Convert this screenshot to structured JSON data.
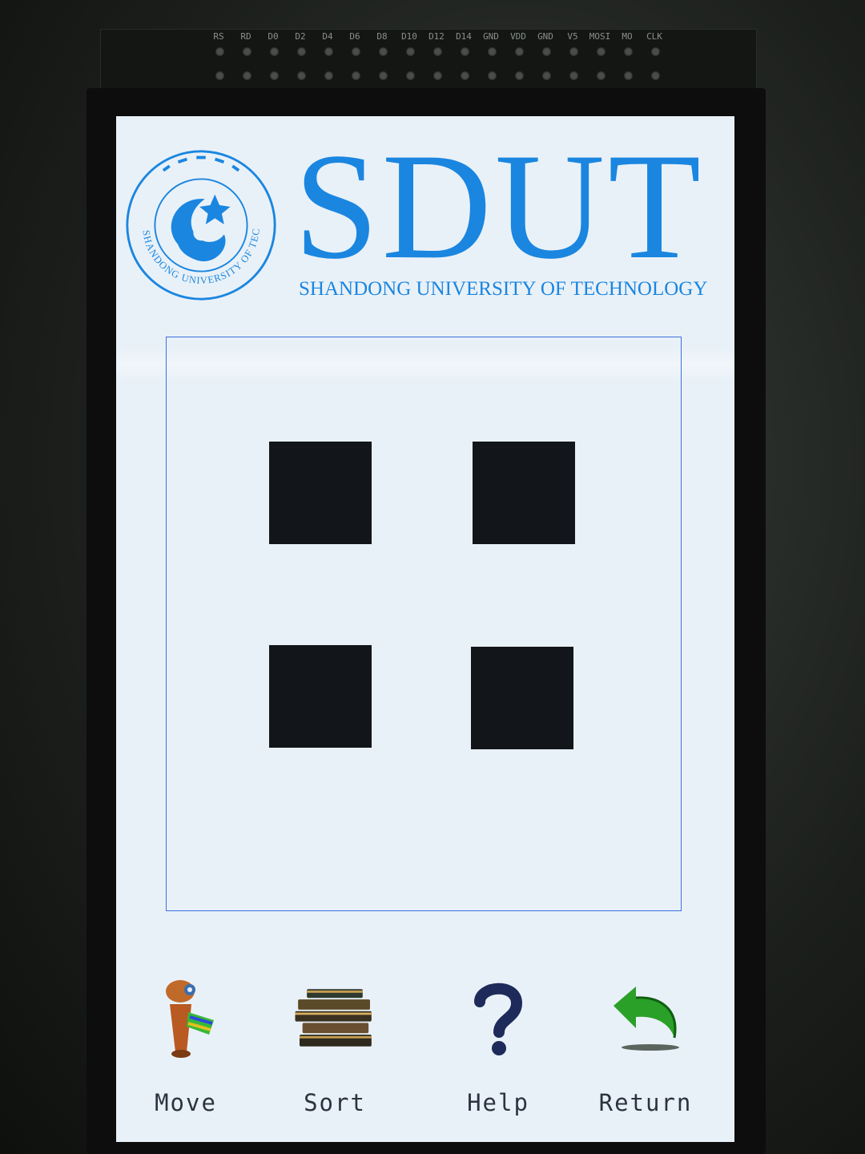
{
  "hardware": {
    "pin_labels": [
      "RS",
      "RD",
      "D0",
      "D2",
      "D4",
      "D6",
      "D8",
      "D10",
      "D12",
      "D14",
      "GND",
      "VDD",
      "GND",
      "V5",
      "MOSI",
      "MO",
      "CLK"
    ]
  },
  "header": {
    "brand": "SDUT",
    "subtitle": "SHANDONG UNIVERSITY OF TECHNOLOGY",
    "seal_text": "SHANDONG UNIVERSITY OF TECHNOLOGY",
    "brand_color": "#1a86e0"
  },
  "board": {
    "border_color": "#3c6fe0",
    "tile_color": "#12151a",
    "tiles": [
      {
        "row": 1,
        "col": 1
      },
      {
        "row": 1,
        "col": 2
      },
      {
        "row": 2,
        "col": 1
      },
      {
        "row": 2,
        "col": 2
      }
    ]
  },
  "toolbar": {
    "move_label": "Move",
    "sort_label": "Sort",
    "help_label": "Help",
    "return_label": "Return",
    "icons": {
      "move": "robot-icon",
      "sort": "books-icon",
      "help": "question-mark-icon",
      "return": "return-arrow-icon"
    }
  }
}
